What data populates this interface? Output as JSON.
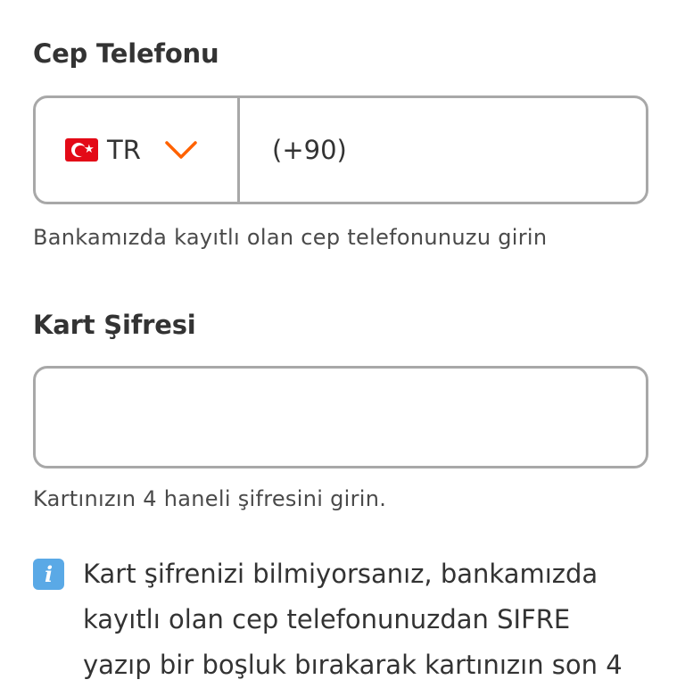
{
  "phone_section": {
    "label": "Cep Telefonu",
    "country_code": "TR",
    "flag_icon": "turkey-flag-icon",
    "dropdown_icon": "chevron-down-icon",
    "dial_prefix": "(+90)",
    "hint": "Bankamızda kayıtlı olan cep telefonunuzu girin"
  },
  "pin_section": {
    "label": "Kart Şifresi",
    "value": "",
    "hint": "Kartınızın 4 haneli şifresini girin."
  },
  "info": {
    "icon": "info-icon",
    "lines": [
      "Kart şifrenizi bilmiyorsanız, bankamızda",
      "kayıtlı olan cep telefonunuzdan SIFRE",
      "yazıp bir boşluk bırakarak kartınızın son 4"
    ]
  },
  "colors": {
    "accent": "#ff6200",
    "border": "#a8a8a8",
    "text": "#333333",
    "info_icon_bg": "#5aa9e6",
    "flag_red": "#e30a17"
  }
}
